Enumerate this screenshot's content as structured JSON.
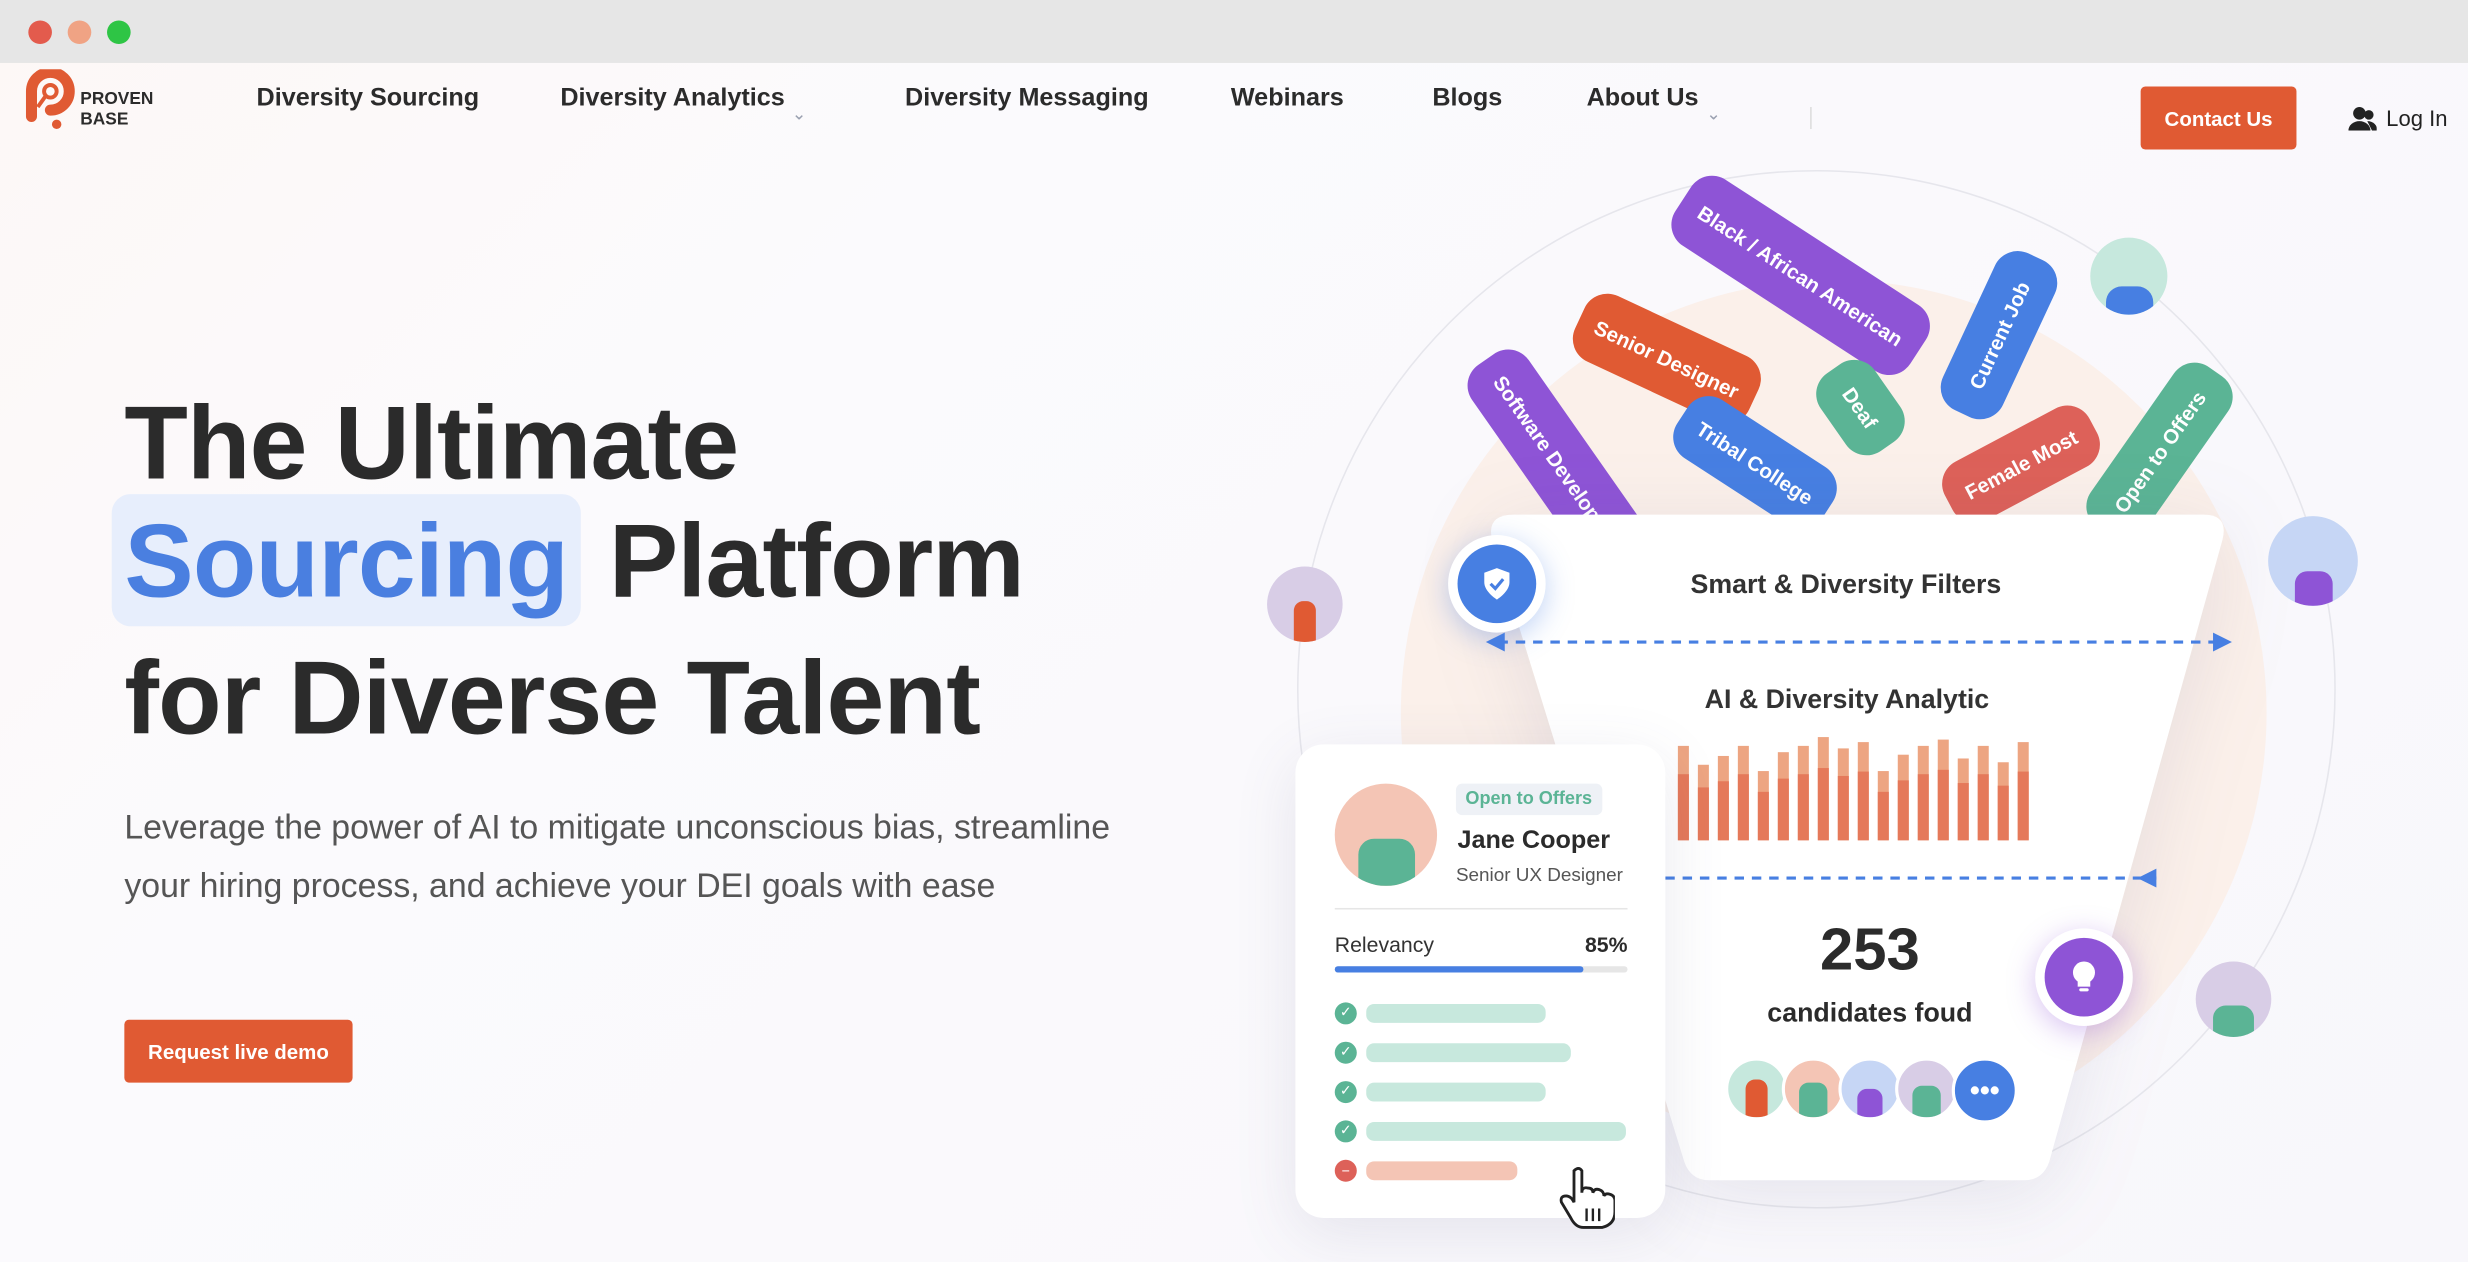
{
  "brand": {
    "line1": "PROVEN",
    "line2": "BASE",
    "color": "#e05a33"
  },
  "nav": {
    "items": [
      {
        "label": "Diversity Sourcing",
        "dropdown": false
      },
      {
        "label": "Diversity Analytics",
        "dropdown": true
      },
      {
        "label": "Diversity Messaging",
        "dropdown": false
      },
      {
        "label": "Webinars",
        "dropdown": false
      },
      {
        "label": "Blogs",
        "dropdown": false
      },
      {
        "label": "About Us",
        "dropdown": true
      }
    ],
    "contact_label": "Contact Us",
    "login_label": "Log In"
  },
  "hero": {
    "title_line1": "The Ultimate",
    "title_highlight": "Sourcing",
    "title_line2_rest": "Platform",
    "title_line3": "for Diverse Talent",
    "paragraph": "Leverage the power of AI to mitigate unconscious bias, streamline your hiring process, and achieve your DEI goals with ease",
    "cta_label": "Request live demo"
  },
  "illustration": {
    "tags": [
      {
        "label": "Black / African American",
        "color": "#8e54d6"
      },
      {
        "label": "Senior Designer",
        "color": "#e05a33"
      },
      {
        "label": "Current Job",
        "color": "#477fe2"
      },
      {
        "label": "Deaf",
        "color": "#5bb495"
      },
      {
        "label": "Software Developer",
        "color": "#8e54d6"
      },
      {
        "label": "Tribal College",
        "color": "#477fe2"
      },
      {
        "label": "Female Most",
        "color": "#dd6159"
      },
      {
        "label": "Open to Offers",
        "color": "#5bb495"
      }
    ],
    "filters_label": "Smart & Diversity Filters",
    "analytics_label": "AI & Diversity Analytic",
    "bars": [
      0.75,
      0.6,
      0.67,
      0.75,
      0.55,
      0.7,
      0.75,
      0.82,
      0.73,
      0.78,
      0.55,
      0.68,
      0.75,
      0.8,
      0.65,
      0.75,
      0.62,
      0.78
    ],
    "count": "253",
    "count_label": "candidates foud",
    "more_icon": "ellipsis"
  },
  "profile": {
    "badge": "Open to Offers",
    "name": "Jane Cooper",
    "role": "Senior UX Designer",
    "relevancy_label": "Relevancy",
    "relevancy_value": "85%",
    "relevancy_fraction": 0.85,
    "criteria": [
      {
        "status": "match",
        "level": 0.69
      },
      {
        "status": "match",
        "level": 0.79
      },
      {
        "status": "match",
        "level": 0.69
      },
      {
        "status": "match",
        "level": 1.0
      },
      {
        "status": "miss",
        "level": 0.58
      }
    ]
  },
  "colors": {
    "accent": "#e05a33",
    "blue": "#477fe2",
    "green": "#5bb495",
    "purple": "#8e54d6"
  }
}
